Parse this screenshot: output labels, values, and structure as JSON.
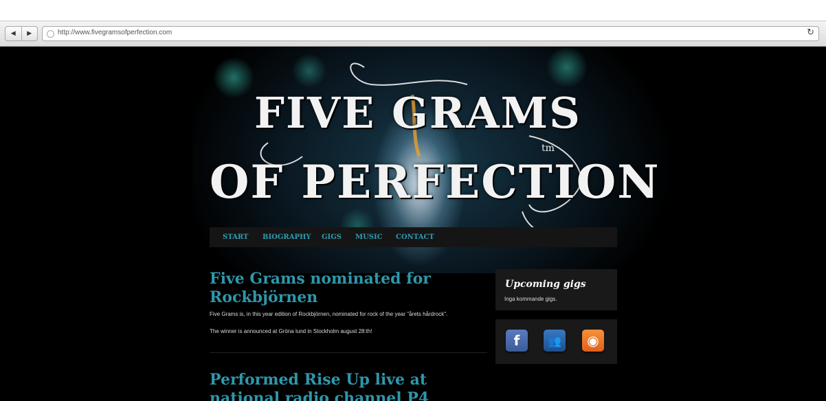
{
  "browser": {
    "url": "http://www.fivegramsofperfection.com",
    "back_glyph": "◀",
    "forward_glyph": "▶",
    "reload_glyph": "↻"
  },
  "site": {
    "logo": {
      "line1": "FIVE GRAMS",
      "line2": "OF PERFECTION",
      "tm": "tm"
    },
    "nav": [
      "START",
      "BIOGRAPHY",
      "GIGS",
      "MUSIC",
      "CONTACT"
    ],
    "accent_color": "#2f97ab"
  },
  "posts": [
    {
      "title": "Five Grams nominated for Rockbjörnen",
      "paragraphs": [
        "Five Grams is, in this year edition of Rockbjörnen, nominated for rock of the year \"årets hårdrock\".",
        "The winner is announced at Gröna lund in Stockholm august 28:th!"
      ]
    },
    {
      "title": "Performed Rise Up live at national radio channel P4"
    }
  ],
  "sidebar": {
    "upcoming": {
      "title": "Upcoming gigs",
      "text": "Inga kommande gigs."
    },
    "social": [
      {
        "name": "facebook-icon",
        "glyph": "f",
        "color": "#3b5b98"
      },
      {
        "name": "myspace-icon",
        "glyph": "👥",
        "color": "#1d4f8c"
      },
      {
        "name": "rss-icon",
        "glyph": "◉",
        "color": "#e0601b"
      }
    ]
  }
}
